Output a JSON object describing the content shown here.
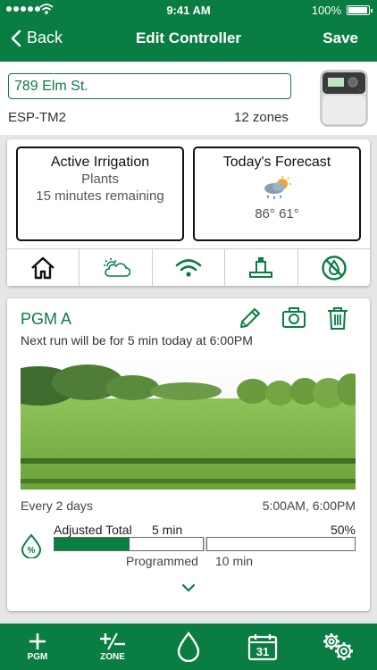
{
  "status_bar": {
    "time": "9:41 AM",
    "battery": "100%"
  },
  "nav": {
    "back_label": "Back",
    "title": "Edit Controller",
    "save_label": "Save"
  },
  "controller": {
    "address_value": "789 Elm St.",
    "model": "ESP-TM2",
    "zones": "12 zones"
  },
  "active_irrigation": {
    "title": "Active Irrigation",
    "program": "Plants",
    "remaining": "15 minutes remaining"
  },
  "forecast": {
    "title": "Today's Forecast",
    "temps": "86° 61°",
    "icon": "rain-cloud-sun-icon"
  },
  "tabs": [
    {
      "icon": "home-icon"
    },
    {
      "icon": "cloud-sun-icon"
    },
    {
      "icon": "wifi-icon"
    },
    {
      "icon": "sprinkler-icon"
    },
    {
      "icon": "water-off-icon"
    }
  ],
  "program": {
    "name": "PGM A",
    "next_run": "Next run will be for 5 min today at 6:00PM",
    "frequency": "Every 2 days",
    "start_times": "5:00AM, 6:00PM",
    "adjusted_label": "Adjusted Total",
    "adjusted_value": "5 min",
    "adjust_percent": "50%",
    "adjust_fraction": 0.5,
    "programmed_label": "Programmed",
    "programmed_value": "10 min"
  },
  "footer": {
    "pgm_label": "PGM",
    "zone_label": "ZONE",
    "calendar_day": "31"
  },
  "colors": {
    "brand_green": "#0a7d43",
    "background": "#e6e6e6"
  }
}
